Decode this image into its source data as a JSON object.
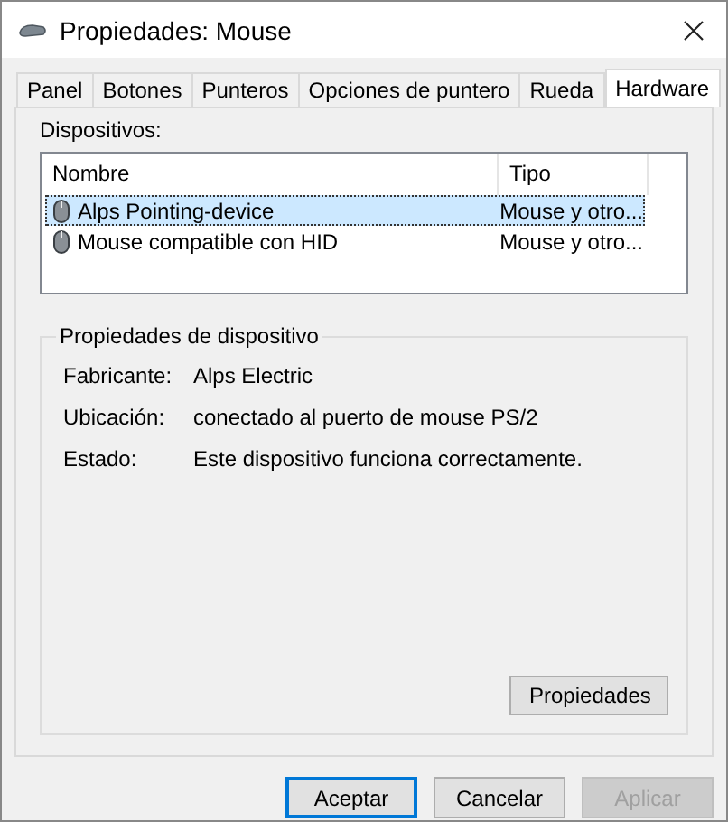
{
  "window": {
    "title": "Propiedades: Mouse"
  },
  "tabs": [
    {
      "label": "Panel",
      "selected": false
    },
    {
      "label": "Botones",
      "selected": false
    },
    {
      "label": "Punteros",
      "selected": false
    },
    {
      "label": "Opciones de puntero",
      "selected": false
    },
    {
      "label": "Rueda",
      "selected": false
    },
    {
      "label": "Hardware",
      "selected": true
    }
  ],
  "devices": {
    "label": "Dispositivos:",
    "columns": [
      "Nombre",
      "Tipo"
    ],
    "rows": [
      {
        "name": "Alps Pointing-device",
        "type": "Mouse y otro...",
        "selected": true
      },
      {
        "name": "Mouse compatible con HID",
        "type": "Mouse y otro...",
        "selected": false
      }
    ]
  },
  "device_properties": {
    "title": "Propiedades de dispositivo",
    "fields": [
      {
        "label": "Fabricante:",
        "value": "Alps Electric"
      },
      {
        "label": "Ubicación:",
        "value": "conectado al puerto de mouse PS/2"
      },
      {
        "label": "Estado:",
        "value": "Este dispositivo funciona correctamente."
      }
    ],
    "button": "Propiedades"
  },
  "buttons": [
    {
      "label": "Aceptar",
      "default": true,
      "disabled": false
    },
    {
      "label": "Cancelar",
      "default": false,
      "disabled": false
    },
    {
      "label": "Aplicar",
      "default": false,
      "disabled": true
    }
  ]
}
